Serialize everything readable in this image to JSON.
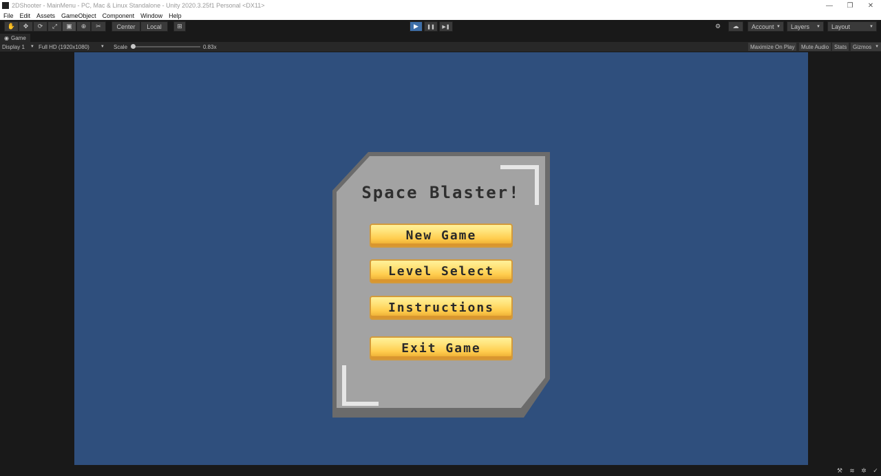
{
  "window": {
    "title": "2DShooter - MainMenu - PC, Mac & Linux Standalone - Unity 2020.3.25f1 Personal <DX11>",
    "controls": {
      "minimize": "—",
      "restore": "❐",
      "close": "✕"
    }
  },
  "menu": [
    "File",
    "Edit",
    "Assets",
    "GameObject",
    "Component",
    "Window",
    "Help"
  ],
  "toolbar": {
    "tools": [
      {
        "name": "hand-tool",
        "icon": "✋"
      },
      {
        "name": "move-tool",
        "icon": "✥"
      },
      {
        "name": "rotate-tool",
        "icon": "⟳"
      },
      {
        "name": "scale-tool",
        "icon": "⤢"
      },
      {
        "name": "rect-tool",
        "icon": "▣"
      },
      {
        "name": "transform-tool",
        "icon": "⊕"
      },
      {
        "name": "custom-tool",
        "icon": "✂"
      }
    ],
    "pivot_label": "Center",
    "space_label": "Local",
    "grid_icon": "⊞",
    "play_icon": "▶",
    "pause_icon": "❚❚",
    "step_icon": "▶❚",
    "collab_icon": "⚙",
    "cloud_icon": "☁",
    "account_label": "Account",
    "layers_label": "Layers",
    "layout_label": "Layout"
  },
  "game_tab": {
    "label": "Game",
    "icon": "◉"
  },
  "game_bar": {
    "display": "Display 1",
    "resolution": "Full HD (1920x1080)",
    "scale_label": "Scale",
    "scale_value": "0.83x",
    "maximize": "Maximize On Play",
    "mute": "Mute Audio",
    "stats": "Stats",
    "gizmos": "Gizmos"
  },
  "game": {
    "title": "Space Blaster!",
    "buttons": [
      {
        "label": "New Game"
      },
      {
        "label": "Level Select"
      },
      {
        "label": "Instructions"
      },
      {
        "label": "Exit Game"
      }
    ]
  },
  "colors": {
    "background": "#2f4f7d",
    "panel": "#a3a3a3",
    "panel_shadow": "#6b6b6b",
    "button_yellow": "#ffd95a",
    "editor_dark": "#191919"
  }
}
